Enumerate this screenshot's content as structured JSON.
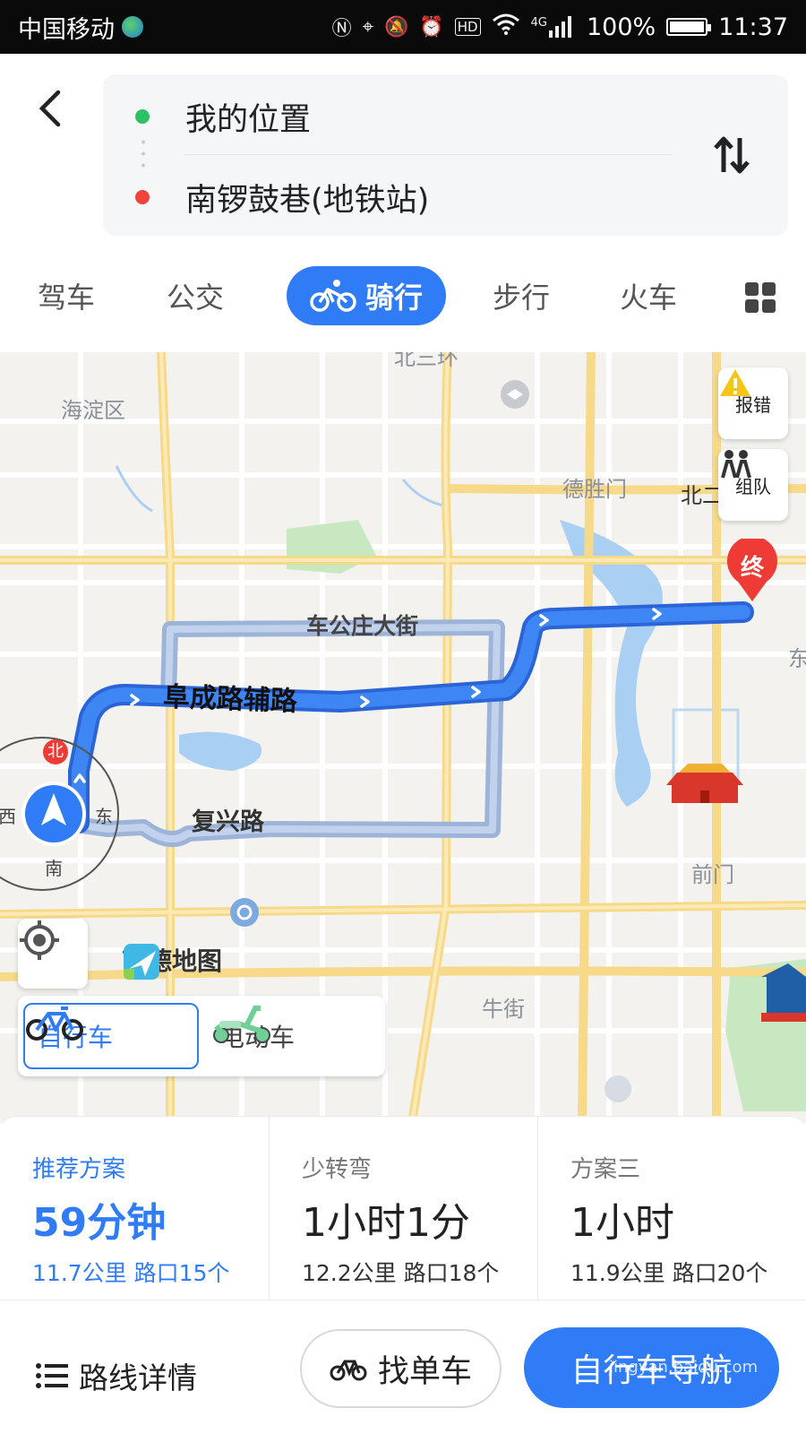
{
  "status_bar": {
    "carrier": "中国移动",
    "battery": "100%",
    "time": "11:37",
    "icons": [
      "nfc-icon",
      "location-icon",
      "mute-icon",
      "alarm-icon",
      "hd-icon",
      "wifi-icon",
      "signal-icon"
    ],
    "network": "4G",
    "hd_label": "HD"
  },
  "header": {
    "from": "我的位置",
    "to": "南锣鼓巷(地铁站)",
    "back_icon": "chevron-left-icon",
    "swap_icon": "swap-vertical-icon"
  },
  "tabs": {
    "items": [
      "驾车",
      "公交",
      "骑行",
      "步行",
      "火车"
    ],
    "active": "骑行"
  },
  "map": {
    "labels": {
      "haidian": "海淀区",
      "deshengmen": "德胜门",
      "beier": "北二",
      "chegongzhuang": "车公庄大街",
      "fuchenglu": "阜成路辅路",
      "fuxinglu": "复兴路",
      "qianmen": "前门",
      "niujie": "牛街",
      "dong": "东",
      "top_ring": "北三环"
    },
    "buttons": {
      "report": "报错",
      "team": "组队"
    },
    "end_pin": "终",
    "compass": {
      "north": "北",
      "south": "南",
      "east": "东",
      "west": "西"
    },
    "logo_text": "高德地图",
    "modes": {
      "bike": "自行车",
      "ebike": "电动车"
    }
  },
  "plans": [
    {
      "name": "推荐方案",
      "time": "59分钟",
      "meta": "11.7公里 路口15个"
    },
    {
      "name": "少转弯",
      "time": "1小时1分",
      "meta": "12.2公里 路口18个"
    },
    {
      "name": "方案三",
      "time": "1小时",
      "meta": "11.9公里 路口20个"
    }
  ],
  "bottom": {
    "detail": "路线详情",
    "find_bike": "找单车",
    "navigate": "自行车导航",
    "watermark": "jingyan.baidu.com"
  },
  "colors": {
    "accent": "#2f7cf6",
    "route_active": "#3478f0",
    "route_alt": "#9db3d8",
    "road_major": "#f7d98a",
    "water": "#a9cff2",
    "park": "#c8e8c2"
  }
}
